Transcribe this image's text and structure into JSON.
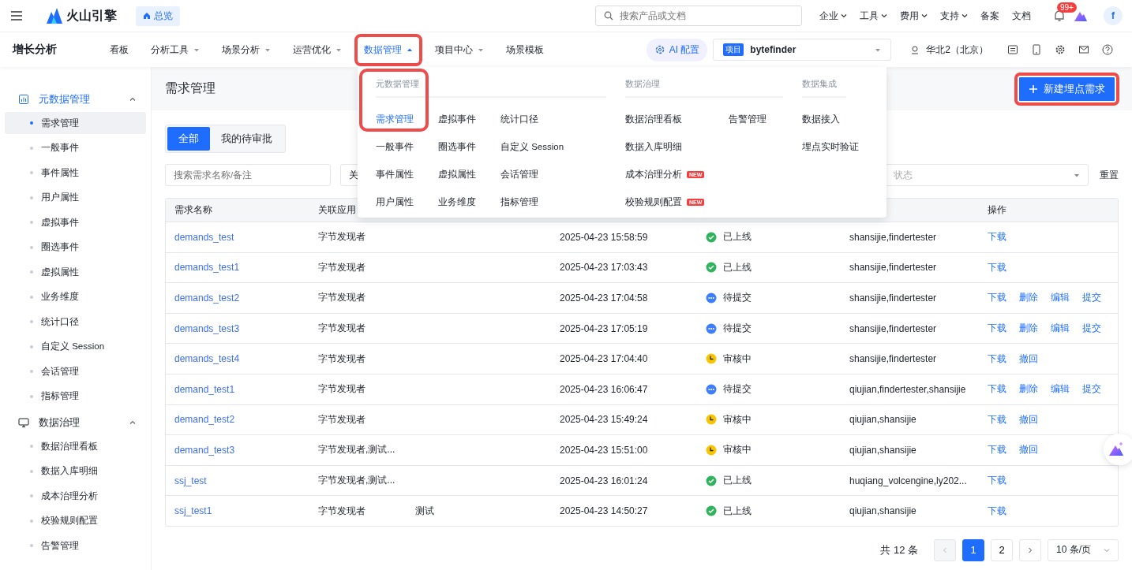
{
  "topbar": {
    "logo": "火山引擎",
    "overview": "总览",
    "search": {
      "placeholder": "搜索产品或文档"
    },
    "menus": [
      {
        "label": "企业",
        "caret": true
      },
      {
        "label": "工具",
        "caret": true
      },
      {
        "label": "费用",
        "caret": true
      },
      {
        "label": "支持",
        "caret": true
      },
      {
        "label": "备案",
        "caret": false
      },
      {
        "label": "文档",
        "caret": false
      }
    ],
    "notification_badge": "99+",
    "avatar": "f"
  },
  "navbar": {
    "title": "增长分析",
    "items": [
      {
        "label": "看板",
        "caret": false,
        "selected": false,
        "highlighted": false
      },
      {
        "label": "分析工具",
        "caret": true,
        "selected": false,
        "highlighted": false
      },
      {
        "label": "场景分析",
        "caret": true,
        "selected": false,
        "highlighted": false
      },
      {
        "label": "运营优化",
        "caret": true,
        "selected": false,
        "highlighted": false
      },
      {
        "label": "数据管理",
        "caret": true,
        "selected": true,
        "highlighted": true
      },
      {
        "label": "项目中心",
        "caret": true,
        "selected": false,
        "highlighted": false
      },
      {
        "label": "场景模板",
        "caret": false,
        "selected": false,
        "highlighted": false
      }
    ],
    "ai_button": "AI 配置",
    "project": {
      "tag": "项目",
      "value": "bytefinder"
    },
    "region": "华北2（北京）"
  },
  "sidebar": [
    {
      "label": "元数据管理",
      "expanded": true,
      "children": [
        {
          "label": "需求管理",
          "selected": true
        },
        {
          "label": "一般事件",
          "selected": false
        },
        {
          "label": "事件属性",
          "selected": false
        },
        {
          "label": "用户属性",
          "selected": false
        },
        {
          "label": "虚拟事件",
          "selected": false
        },
        {
          "label": "圈选事件",
          "selected": false
        },
        {
          "label": "虚拟属性",
          "selected": false
        },
        {
          "label": "业务维度",
          "selected": false
        },
        {
          "label": "统计口径",
          "selected": false
        },
        {
          "label": "自定义 Session",
          "selected": false
        },
        {
          "label": "会话管理",
          "selected": false
        },
        {
          "label": "指标管理",
          "selected": false
        }
      ]
    },
    {
      "label": "数据治理",
      "expanded": true,
      "children": [
        {
          "label": "数据治理看板",
          "selected": false
        },
        {
          "label": "数据入库明细",
          "selected": false
        },
        {
          "label": "成本治理分析",
          "selected": false
        },
        {
          "label": "校验规则配置",
          "selected": false
        },
        {
          "label": "告警管理",
          "selected": false
        }
      ]
    }
  ],
  "dropdown": [
    {
      "title": "元数据管理",
      "highlighted": true,
      "columns": [
        [
          {
            "label": "需求管理",
            "selected": true
          },
          {
            "label": "一般事件",
            "selected": false
          },
          {
            "label": "事件属性",
            "selected": false
          },
          {
            "label": "用户属性",
            "selected": false
          }
        ],
        [
          {
            "label": "虚拟事件",
            "selected": false
          },
          {
            "label": "圈选事件",
            "selected": false
          },
          {
            "label": "虚拟属性",
            "selected": false
          },
          {
            "label": "业务维度",
            "selected": false
          }
        ],
        [
          {
            "label": "统计口径",
            "selected": false
          },
          {
            "label": "自定义 Session",
            "selected": false
          },
          {
            "label": "会话管理",
            "selected": false
          },
          {
            "label": "指标管理",
            "selected": false
          }
        ]
      ]
    },
    {
      "title": "数据治理",
      "highlighted": false,
      "columns": [
        [
          {
            "label": "数据治理看板",
            "selected": false
          },
          {
            "label": "数据入库明细",
            "selected": false
          },
          {
            "label": "成本治理分析",
            "selected": false,
            "badge": "NEW"
          },
          {
            "label": "校验规则配置",
            "selected": false,
            "badge": "NEW"
          }
        ],
        [
          {
            "label": "告警管理",
            "selected": false
          }
        ]
      ]
    },
    {
      "title": "数据集成",
      "highlighted": false,
      "columns": [
        [
          {
            "label": "数据接入",
            "selected": false
          },
          {
            "label": "埋点实时验证",
            "selected": false
          }
        ]
      ]
    }
  ],
  "page": {
    "title": "需求管理",
    "new_button": {
      "label": "新建埋点需求",
      "highlighted": true
    },
    "tabs": [
      {
        "label": "全部",
        "selected": true
      },
      {
        "label": "我的待审批",
        "selected": false
      }
    ],
    "filters": {
      "search_placeholder": "搜索需求名称/备注",
      "select_placeholder": "关",
      "status_placeholder": "状态",
      "reset": "重置"
    },
    "table": {
      "columns": [
        "需求名称",
        "关联应用",
        "操作"
      ],
      "rows": [
        {
          "name": "demands_test",
          "app": "字节发现者",
          "time": "2025-04-23 15:58:59",
          "status": {
            "kind": "online",
            "label": "已上线"
          },
          "owners": "shansijie,findertester",
          "actions": [
            "下载"
          ]
        },
        {
          "name": "demands_test1",
          "app": "字节发现者",
          "time": "2025-04-23 17:03:43",
          "status": {
            "kind": "online",
            "label": "已上线"
          },
          "owners": "shansijie,findertester",
          "actions": [
            "下载"
          ]
        },
        {
          "name": "demands_test2",
          "app": "字节发现者",
          "time": "2025-04-23 17:04:58",
          "status": {
            "kind": "pending",
            "label": "待提交"
          },
          "owners": "shansijie,findertester",
          "actions": [
            "下载",
            "删除",
            "编辑",
            "提交"
          ]
        },
        {
          "name": "demands_test3",
          "app": "字节发现者",
          "time": "2025-04-23 17:05:19",
          "status": {
            "kind": "pending",
            "label": "待提交"
          },
          "owners": "shansijie,findertester",
          "actions": [
            "下载",
            "删除",
            "编辑",
            "提交"
          ]
        },
        {
          "name": "demands_test4",
          "app": "字节发现者",
          "time": "2025-04-23 17:04:40",
          "status": {
            "kind": "review",
            "label": "审核中"
          },
          "owners": "shansijie,findertester",
          "actions": [
            "下载",
            "撤回"
          ]
        },
        {
          "name": "demand_test1",
          "app": "字节发现者",
          "time": "2025-04-23 16:06:47",
          "status": {
            "kind": "pending",
            "label": "待提交"
          },
          "owners": "qiujian,findertester,shansijie",
          "actions": [
            "下载",
            "删除",
            "编辑",
            "提交"
          ]
        },
        {
          "name": "demand_test2",
          "app": "字节发现者",
          "time": "2025-04-23 15:49:24",
          "status": {
            "kind": "review",
            "label": "审核中"
          },
          "owners": "qiujian,shansijie",
          "actions": [
            "下载",
            "撤回"
          ]
        },
        {
          "name": "demand_test3",
          "app": "字节发现者,测试...",
          "time": "2025-04-23 15:51:00",
          "status": {
            "kind": "review",
            "label": "审核中"
          },
          "owners": "qiujian,shansijie",
          "actions": [
            "下载",
            "撤回"
          ]
        },
        {
          "name": "ssj_test",
          "app": "字节发现者,测试...",
          "time": "2025-04-23 16:01:24",
          "status": {
            "kind": "online",
            "label": "已上线"
          },
          "owners": "huqiang_volcengine,ly202...",
          "actions": [
            "下载"
          ]
        },
        {
          "name": "ssj_test1",
          "app": "字节发现者",
          "column_3": "测试",
          "time": "2025-04-23 14:50:27",
          "status": {
            "kind": "online",
            "label": "已上线"
          },
          "owners": "qiujian,shansijie",
          "actions": [
            "下载"
          ]
        }
      ]
    },
    "pagination": {
      "total": "共 12 条",
      "prev_disabled": true,
      "pages": [
        {
          "label": "1",
          "selected": true
        },
        {
          "label": "2",
          "selected": false
        }
      ],
      "page_size": "10 条/页"
    }
  }
}
